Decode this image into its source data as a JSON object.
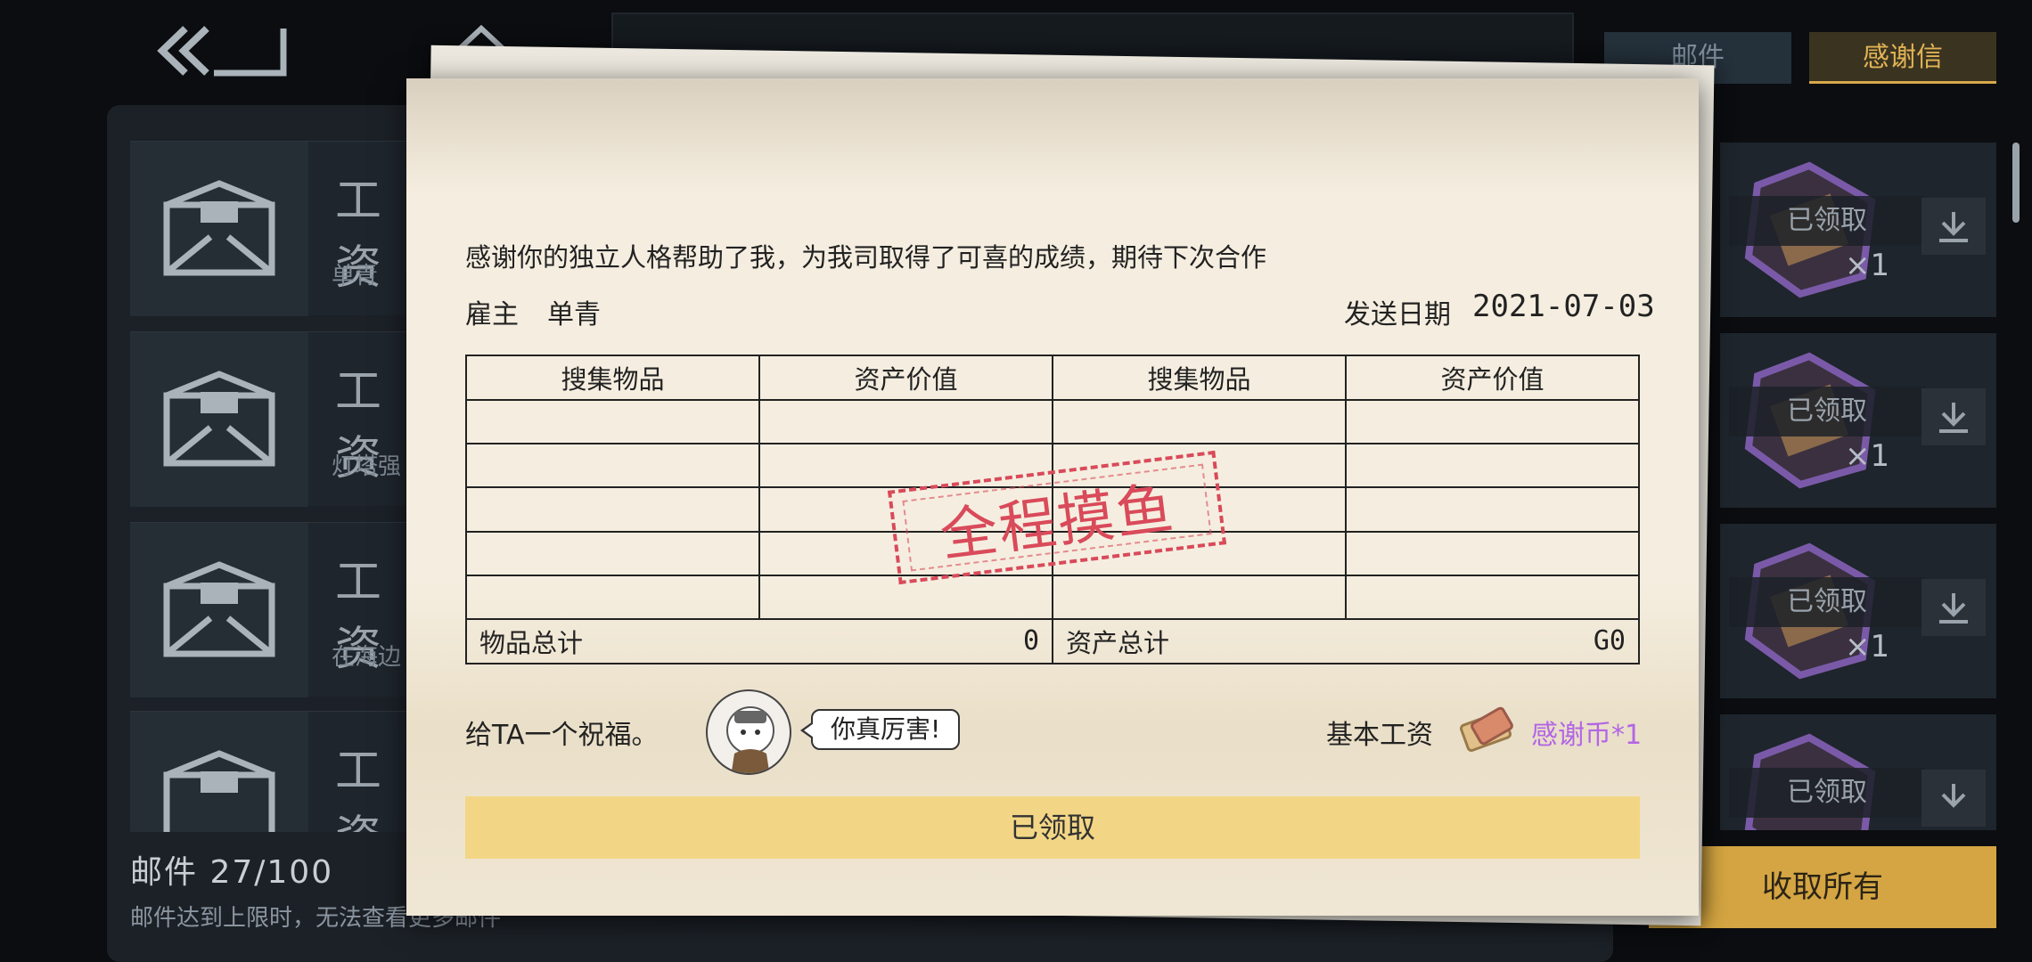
{
  "nav": {
    "back_icon": "double-chevron-left-icon",
    "home_icon": "home-icon"
  },
  "tabs": [
    {
      "label": "邮件",
      "active": false
    },
    {
      "label": "感谢信",
      "active": true
    }
  ],
  "mail_list": [
    {
      "title": "工资",
      "from": "单青"
    },
    {
      "title": "工资",
      "from": "灯塔强"
    },
    {
      "title": "工资",
      "from": "在海边"
    },
    {
      "title": "工资",
      "from": ""
    }
  ],
  "rewards": [
    {
      "status": "已领取",
      "qty": "×1"
    },
    {
      "status": "已领取",
      "qty": "×1"
    },
    {
      "status": "已领取",
      "qty": "×1"
    },
    {
      "status": "已领取",
      "qty": ""
    }
  ],
  "footer": {
    "mail_count": "邮件 27/100",
    "limit_notice": "邮件达到上限时，无法查看更多邮件",
    "collect_all": "收取所有"
  },
  "letter": {
    "message": "感谢你的独立人格帮助了我，为我司取得了可喜的成绩，期待下次合作",
    "employer_label": "雇主",
    "employer_name": "单青",
    "date_label": "发送日期",
    "date_value": "2021-07-03",
    "table": {
      "headers": [
        "搜集物品",
        "资产价值",
        "搜集物品",
        "资产价值"
      ],
      "item_total_label": "物品总计",
      "item_total_value": "0",
      "asset_total_label": "资产总计",
      "asset_total_value": "G0"
    },
    "stamp": "全程摸鱼",
    "blessing_label": "给TA一个祝福。",
    "blessing_bubble": "你真厉害!",
    "salary_label": "基本工资",
    "salary_value": "感谢币*1",
    "claimed_button": "已领取"
  },
  "colors": {
    "accent_gold": "#d4a542",
    "paper": "#f5eee0",
    "stamp_red": "#d94a5a",
    "salary_purple": "#b266e6",
    "claimed_button": "#f3d685"
  }
}
